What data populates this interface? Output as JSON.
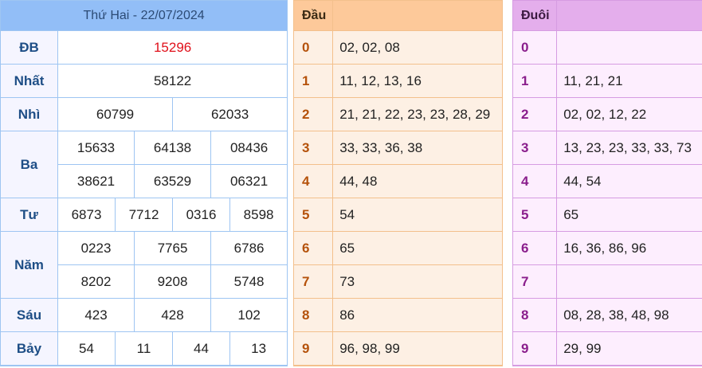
{
  "results": {
    "date_title": "Thứ Hai - 22/07/2024",
    "prizes": {
      "db": {
        "label": "ĐB",
        "values": [
          "15296"
        ]
      },
      "nhat": {
        "label": "Nhất",
        "values": [
          "58122"
        ]
      },
      "nhi": {
        "label": "Nhì",
        "values": [
          "60799",
          "62033"
        ]
      },
      "ba": {
        "label": "Ba",
        "values": [
          "15633",
          "64138",
          "08436",
          "38621",
          "63529",
          "06321"
        ]
      },
      "tu": {
        "label": "Tư",
        "values": [
          "6873",
          "7712",
          "0316",
          "8598"
        ]
      },
      "nam": {
        "label": "Năm",
        "values": [
          "0223",
          "7765",
          "6786",
          "8202",
          "9208",
          "5748"
        ]
      },
      "sau": {
        "label": "Sáu",
        "values": [
          "423",
          "428",
          "102"
        ]
      },
      "bay": {
        "label": "Bảy",
        "values": [
          "54",
          "11",
          "44",
          "13"
        ]
      }
    }
  },
  "head_table": {
    "header": "Đầu",
    "rows": [
      {
        "digit": "0",
        "values": "02, 02, 08"
      },
      {
        "digit": "1",
        "values": "11, 12, 13, 16"
      },
      {
        "digit": "2",
        "values": "21, 21, 22, 23, 23, 28, 29"
      },
      {
        "digit": "3",
        "values": "33, 33, 36, 38"
      },
      {
        "digit": "4",
        "values": "44, 48"
      },
      {
        "digit": "5",
        "values": "54"
      },
      {
        "digit": "6",
        "values": "65"
      },
      {
        "digit": "7",
        "values": "73"
      },
      {
        "digit": "8",
        "values": "86"
      },
      {
        "digit": "9",
        "values": "96, 98, 99"
      }
    ]
  },
  "tail_table": {
    "header": "Đuôi",
    "rows": [
      {
        "digit": "0",
        "values": ""
      },
      {
        "digit": "1",
        "values": "11, 21, 21"
      },
      {
        "digit": "2",
        "values": "02, 02, 12, 22"
      },
      {
        "digit": "3",
        "values": "13, 23, 23, 33, 33, 73"
      },
      {
        "digit": "4",
        "values": "44, 54"
      },
      {
        "digit": "5",
        "values": "65"
      },
      {
        "digit": "6",
        "values": "16, 36, 86, 96"
      },
      {
        "digit": "7",
        "values": ""
      },
      {
        "digit": "8",
        "values": "08, 28, 38, 48, 98"
      },
      {
        "digit": "9",
        "values": "29, 99"
      }
    ]
  },
  "colors": {
    "results_header_bg": "#92bef7",
    "results_border": "#9ec5f2",
    "prize_label_text": "#1e4e86",
    "special_prize_text": "#e0101a",
    "head_header_bg": "#fdc99a",
    "head_row_bg": "#fdf0e4",
    "head_digit_text": "#b5520b",
    "tail_header_bg": "#e4aeec",
    "tail_row_bg": "#fdeefe",
    "tail_digit_text": "#8a1e8c"
  }
}
